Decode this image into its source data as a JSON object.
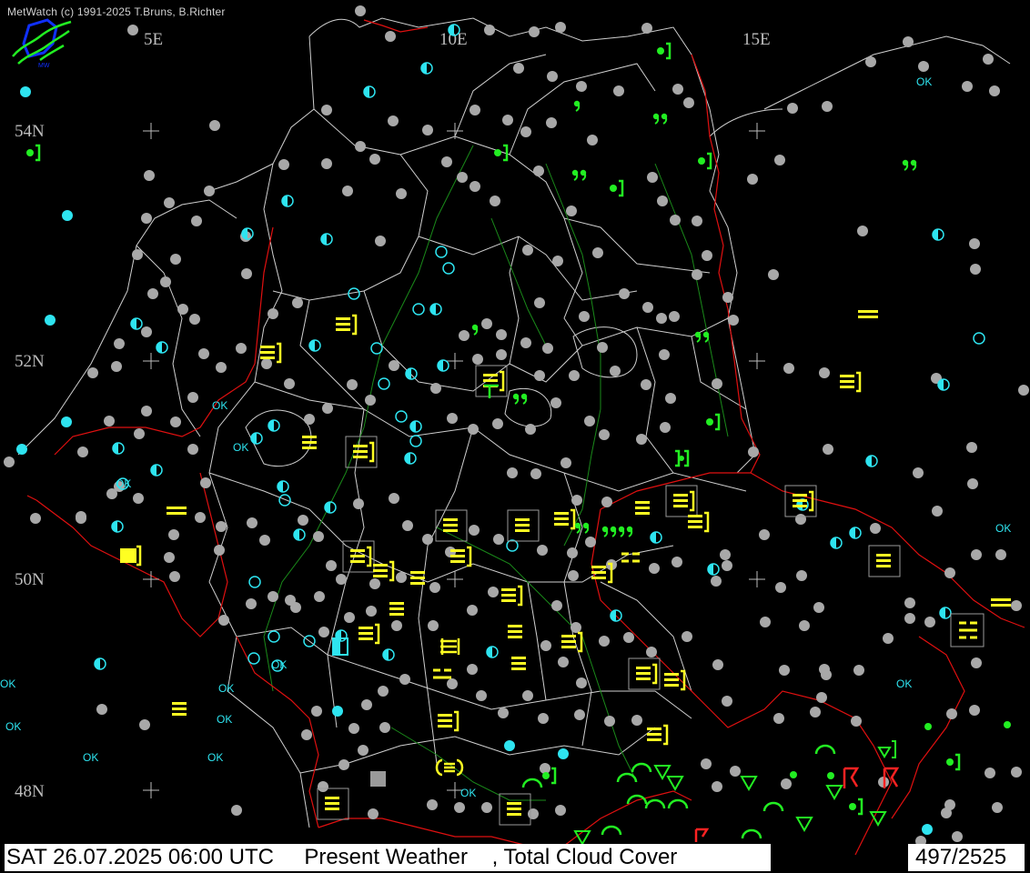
{
  "app": {
    "credit": "MetWatch  (c) 1991-2025 T.Bruns, B.Richter",
    "logo_icon": "metwatch-logo-icon"
  },
  "footer": {
    "datetime": "SAT 26.07.2025 06:00 UTC",
    "product": "Present Weather",
    "product2": ", Total Cloud Cover",
    "count": "497/2525"
  },
  "grid_labels": {
    "lon": [
      "5E",
      "10E",
      "15E"
    ],
    "lat": [
      "54N",
      "52N",
      "50N",
      "48N"
    ]
  },
  "colors": {
    "background": "#000000",
    "admin_lines": "#d0d0d0",
    "country_border": "#e01010",
    "river": "#1a8a1a",
    "station_gray": "#a8a8a8",
    "station_cyan": "#2ee4f0",
    "fog_yellow": "#ffff22",
    "precip_green": "#22ee22",
    "thunder_red": "#ff2222"
  },
  "legend_text": {
    "ok": "OK"
  }
}
